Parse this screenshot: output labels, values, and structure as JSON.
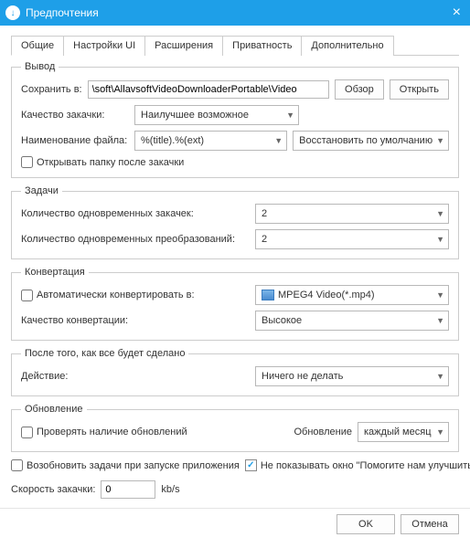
{
  "titlebar": {
    "title": "Предпочтения",
    "close": "×"
  },
  "tabs": [
    "Общие",
    "Настройки UI",
    "Расширения",
    "Приватность",
    "Дополнительно"
  ],
  "output": {
    "legend": "Вывод",
    "saveInLabel": "Сохранить в:",
    "saveInValue": "\\soft\\AllavsoftVideoDownloaderPortable\\Video",
    "browseBtn": "Обзор",
    "openBtn": "Открыть",
    "qualityLabel": "Качество закачки:",
    "qualityValue": "Наилучшее возможное",
    "nameLabel": "Наименование файла:",
    "nameValue": "%(title).%(ext)",
    "restoreBtn": "Восстановить по умолчанию",
    "openFolderLabel": "Открывать папку после закачки"
  },
  "tasks": {
    "legend": "Задачи",
    "simDownloadsLabel": "Количество одновременных закачек:",
    "simDownloadsValue": "2",
    "simConvertLabel": "Количество одновременных преобразований:",
    "simConvertValue": "2"
  },
  "convert": {
    "legend": "Конвертация",
    "autoLabel": "Автоматически конвертировать в:",
    "autoValue": "MPEG4 Video(*.mp4)",
    "qualityLabel": "Качество конвертации:",
    "qualityValue": "Высокое"
  },
  "after": {
    "legend": "После того, как все будет сделано",
    "actionLabel": "Действие:",
    "actionValue": "Ничего не делать"
  },
  "update": {
    "legend": "Обновление",
    "checkLabel": "Проверять наличие обновлений",
    "updateLabel": "Обновление",
    "updateValue": "каждый месяц"
  },
  "bottom": {
    "resumeLabel": "Возобновить задачи при запуске приложения",
    "helpLabel": "Не показывать окно \"Помогите нам улучшить\"",
    "speedLabel": "Скорость закачки:",
    "speedValue": "0",
    "speedUnit": "kb/s"
  },
  "footer": {
    "ok": "OK",
    "cancel": "Отмена"
  }
}
